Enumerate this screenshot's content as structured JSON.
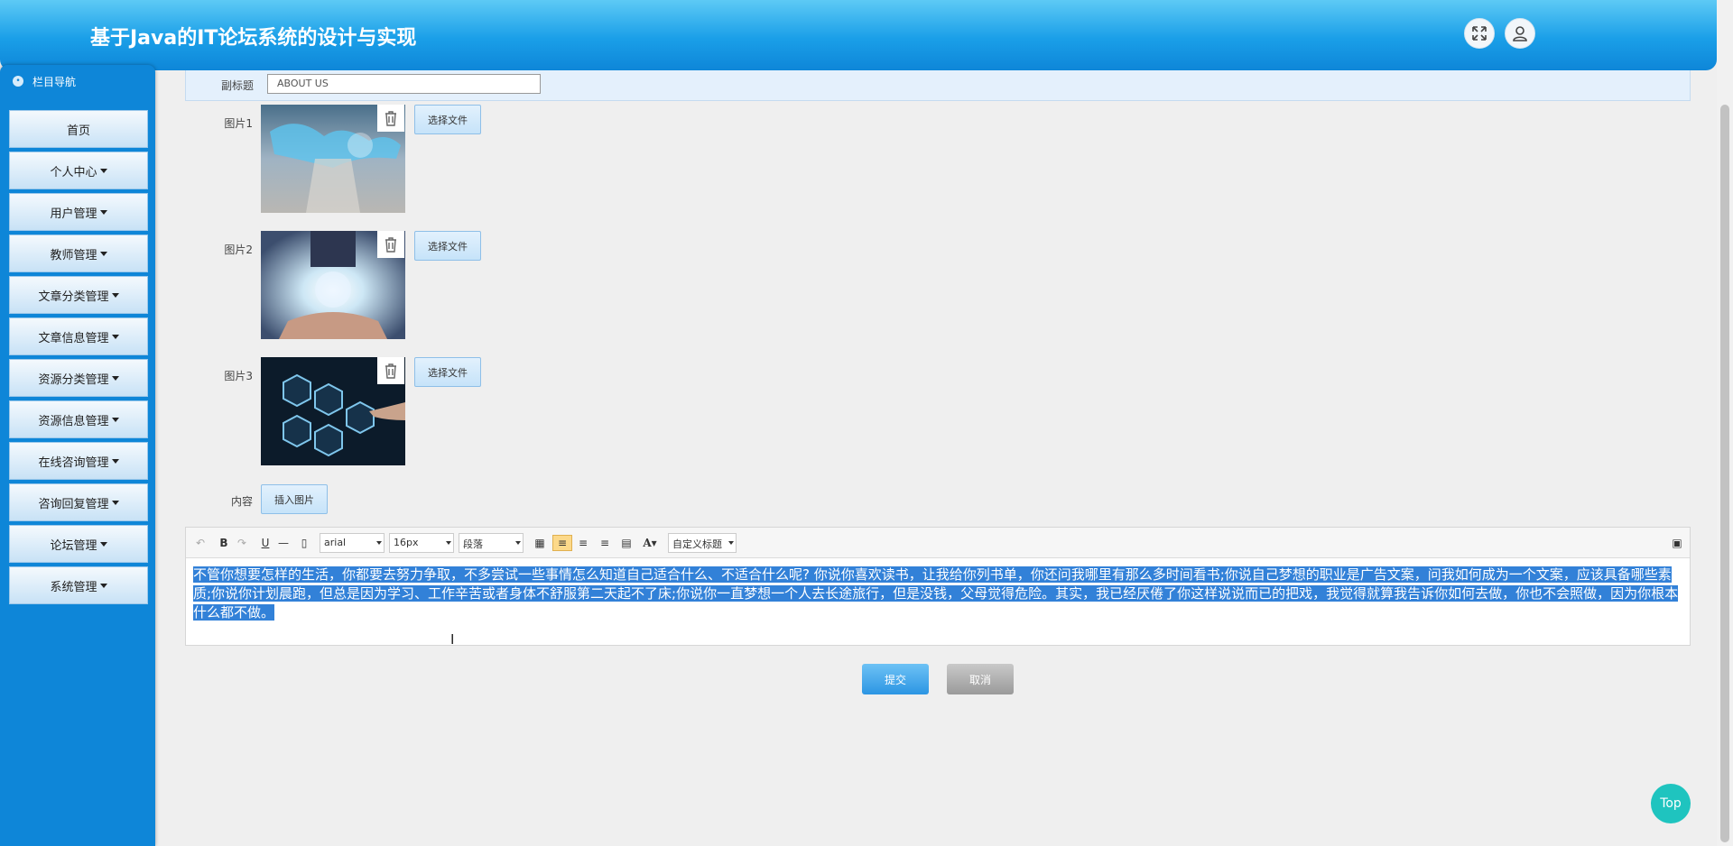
{
  "header": {
    "title": "基于Java的IT论坛系统的设计与实现"
  },
  "icons": {
    "fullscreen": "expand-icon",
    "user": "user-icon",
    "delete": "trash-icon"
  },
  "sidebar": {
    "title": "栏目导航",
    "items": [
      {
        "label": "首页",
        "dropdown": false
      },
      {
        "label": "个人中心",
        "dropdown": true
      },
      {
        "label": "用户管理",
        "dropdown": true
      },
      {
        "label": "教师管理",
        "dropdown": true
      },
      {
        "label": "文章分类管理",
        "dropdown": true
      },
      {
        "label": "文章信息管理",
        "dropdown": true
      },
      {
        "label": "资源分类管理",
        "dropdown": true
      },
      {
        "label": "资源信息管理",
        "dropdown": true
      },
      {
        "label": "在线咨询管理",
        "dropdown": true
      },
      {
        "label": "咨询回复管理",
        "dropdown": true
      },
      {
        "label": "论坛管理",
        "dropdown": true
      },
      {
        "label": "系统管理",
        "dropdown": true
      }
    ]
  },
  "form": {
    "subtitle_label": "副标题",
    "subtitle_value": "ABOUT US",
    "images": [
      {
        "label": "图片1",
        "button": "选择文件"
      },
      {
        "label": "图片2",
        "button": "选择文件"
      },
      {
        "label": "图片3",
        "button": "选择文件"
      }
    ],
    "content_label": "内容",
    "insert_image": "插入图片"
  },
  "editor": {
    "font": "arial",
    "size": "16px",
    "block": "段落",
    "custom_title": "自定义标题",
    "content": "不管你想要怎样的生活，你都要去努力争取，不多尝试一些事情怎么知道自己适合什么、不适合什么呢? 你说你喜欢读书，让我给你列书单，你还问我哪里有那么多时间看书;你说自己梦想的职业是广告文案，问我如何成为一个文案，应该具备哪些素质;你说你计划晨跑，但总是因为学习、工作辛苦或者身体不舒服第二天起不了床;你说你一直梦想一个人去长途旅行，但是没钱，父母觉得危险。其实，我已经厌倦了你这样说说而已的把戏，我觉得就算我告诉你如何去做，你也不会照做，因为你根本什么都不做。"
  },
  "actions": {
    "submit": "提交",
    "cancel": "取消",
    "top": "Top"
  }
}
